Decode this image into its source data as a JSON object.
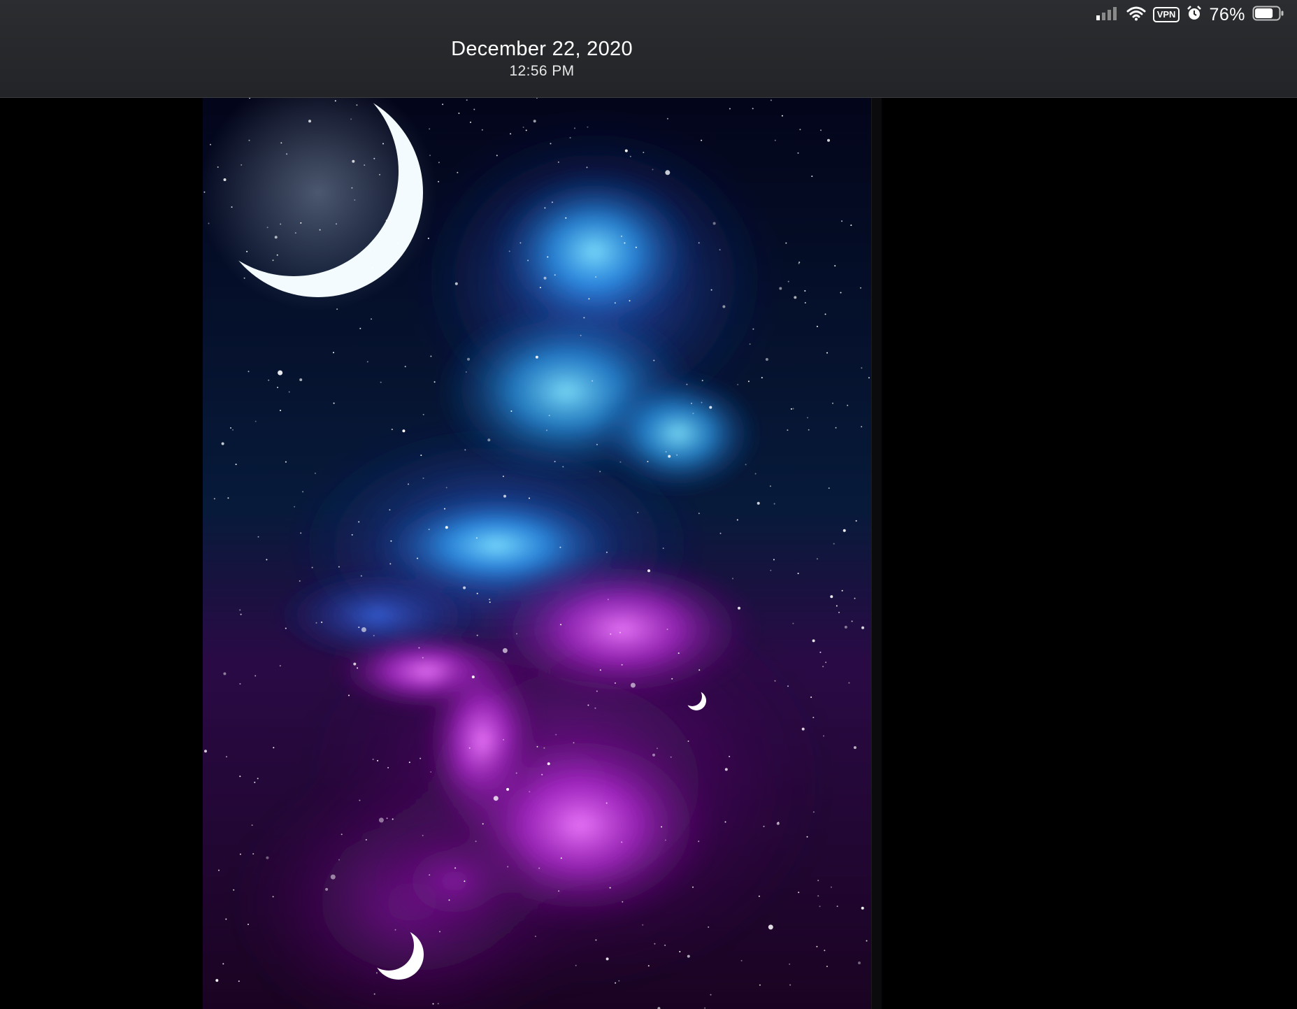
{
  "status_bar": {
    "battery_percent": "76%",
    "vpn_label": "VPN",
    "icons": [
      "cellular-signal-icon",
      "wifi-icon",
      "vpn-icon",
      "alarm-icon",
      "battery-icon"
    ],
    "battery_level": 0.76
  },
  "photo_header": {
    "date": "December 22, 2020",
    "time": "12:56 PM"
  },
  "photo": {
    "subject_icon": "galaxy-nebula-image",
    "colors": {
      "space": "#040615",
      "blue_nebula": "#3fb8ff",
      "purple_nebula": "#c02ad6",
      "moon": "#ffffff"
    }
  }
}
